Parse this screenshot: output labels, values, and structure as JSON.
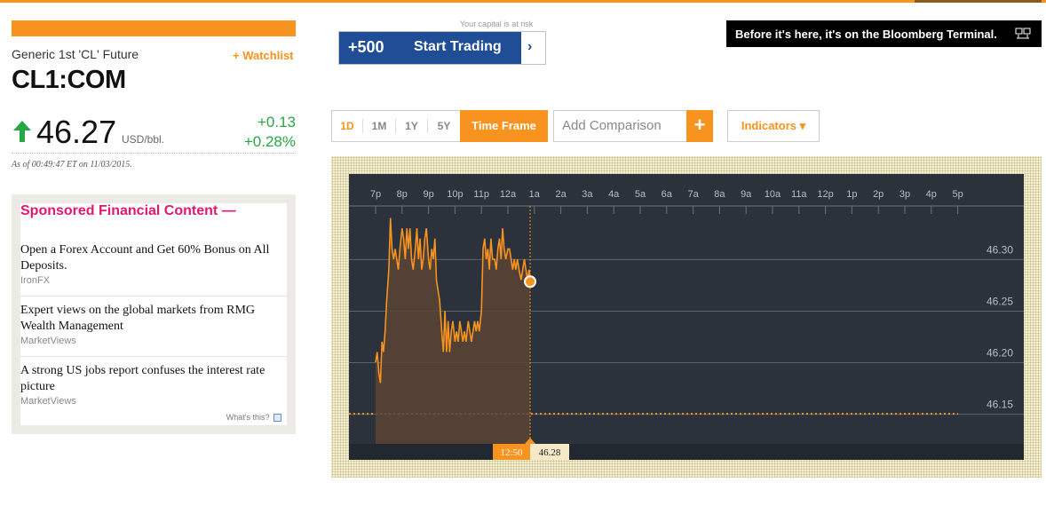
{
  "header": {
    "name": "Generic 1st 'CL' Future",
    "watchlist_label": "+ Watchlist",
    "ticker": "CL1:COM",
    "price": "46.27",
    "unit": "USD/bbl.",
    "change": "+0.13",
    "change_pct": "+0.28%",
    "as_of": "As of 00:49:47 ET on 11/03/2015.",
    "direction": "up",
    "up_color": "#28a745"
  },
  "sponsored": {
    "title": "Sponsored Financial Content —",
    "items": [
      {
        "headline": "Open a Forex Account and Get 60% Bonus on All Deposits.",
        "source": "IronFX"
      },
      {
        "headline": "Expert views on the global markets from RMG Wealth Management",
        "source": "MarketViews"
      },
      {
        "headline": "A strong US jobs report confuses the interest rate picture",
        "source": "MarketViews"
      }
    ],
    "whats_this": "What's this?"
  },
  "trading_banner": {
    "risk_note": "Your capital is at risk",
    "badge": "+500",
    "label": "Start Trading",
    "chevron": "›"
  },
  "bloomberg_ad": {
    "text": "Before it's here, it's on the Bloomberg Terminal.",
    "icon": "monitor-icon"
  },
  "controls": {
    "timeframes": [
      "1D",
      "1M",
      "1Y",
      "5Y"
    ],
    "active_timeframe": "1D",
    "timeframe_button": "Time Frame",
    "add_comparison": "Add Comparison",
    "add_plus": "+",
    "indicators": "Indicators ▾"
  },
  "colors": {
    "accent": "#f7931e",
    "chart_bg": "#2b323b",
    "line": "#f7931e",
    "sponsor_title": "#e2186f",
    "trade_blue": "#1f4e96"
  },
  "chart_data": {
    "type": "line",
    "x_ticks": [
      "7p",
      "8p",
      "9p",
      "10p",
      "11p",
      "12a",
      "1a",
      "2a",
      "3a",
      "4a",
      "5a",
      "6a",
      "7a",
      "8a",
      "9a",
      "10a",
      "11a",
      "12p",
      "1p",
      "2p",
      "3p",
      "4p",
      "5p"
    ],
    "y_ticks": [
      46.3,
      46.25,
      46.2,
      46.15
    ],
    "ylim": [
      46.11,
      46.34
    ],
    "previous_close": 46.14,
    "cursor": {
      "time": "12:50",
      "value": "46.28"
    },
    "current_value": 46.27,
    "series": [
      {
        "x": [
          0,
          0.06,
          0.12,
          0.18,
          0.24,
          0.3,
          0.36,
          0.42,
          0.5,
          0.56,
          0.62,
          0.68,
          0.74,
          0.8,
          0.86,
          0.92,
          1.0,
          1.06,
          1.12,
          1.18,
          1.24,
          1.3,
          1.36,
          1.42,
          1.5,
          1.56,
          1.62,
          1.68,
          1.74,
          1.8,
          1.86,
          1.92,
          2.0,
          2.06,
          2.12,
          2.18,
          2.24,
          2.3,
          2.36,
          2.42,
          2.5,
          2.56,
          2.62,
          2.68,
          2.74,
          2.8,
          2.86,
          2.92,
          3.0,
          3.06,
          3.12,
          3.18,
          3.24,
          3.3,
          3.36,
          3.42,
          3.5,
          3.56,
          3.62,
          3.68,
          3.74,
          3.8,
          3.86,
          3.92,
          4.0,
          4.06,
          4.12,
          4.18,
          4.24,
          4.3,
          4.36,
          4.42,
          4.5,
          4.56,
          4.62,
          4.68,
          4.74,
          4.8,
          4.86,
          4.92,
          5.0,
          5.06,
          5.12,
          5.18,
          5.24,
          5.3,
          5.36,
          5.42,
          5.5,
          5.56,
          5.62,
          5.68,
          5.74,
          5.8,
          5.84
        ],
        "values": [
          46.19,
          46.2,
          46.18,
          46.17,
          46.21,
          46.2,
          46.22,
          46.25,
          46.28,
          46.33,
          46.3,
          46.29,
          46.3,
          46.29,
          46.28,
          46.3,
          46.32,
          46.31,
          46.29,
          46.32,
          46.3,
          46.32,
          46.29,
          46.28,
          46.3,
          46.32,
          46.29,
          46.31,
          46.28,
          46.29,
          46.31,
          46.32,
          46.29,
          46.28,
          46.3,
          46.29,
          46.31,
          46.27,
          46.26,
          46.25,
          46.22,
          46.2,
          46.24,
          46.2,
          46.23,
          46.2,
          46.22,
          46.23,
          46.21,
          46.22,
          46.21,
          46.23,
          46.22,
          46.21,
          46.22,
          46.21,
          46.23,
          46.22,
          46.21,
          46.22,
          46.23,
          46.22,
          46.23,
          46.22,
          46.24,
          46.3,
          46.31,
          46.29,
          46.3,
          46.28,
          46.31,
          46.29,
          46.29,
          46.28,
          46.3,
          46.31,
          46.29,
          46.32,
          46.3,
          46.29,
          46.3,
          46.3,
          46.29,
          46.28,
          46.29,
          46.28,
          46.29,
          46.28,
          46.27,
          46.28,
          46.29,
          46.28,
          46.27,
          46.28,
          46.27
        ]
      }
    ]
  }
}
